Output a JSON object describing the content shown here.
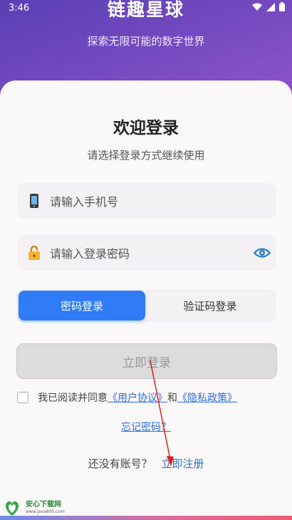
{
  "status_bar": {
    "time": "3:46"
  },
  "header": {
    "app_title": "链趣星球",
    "subtitle": "探索无限可能的数字世界"
  },
  "login": {
    "title": "欢迎登录",
    "subtitle": "请选择登录方式继续使用",
    "phone_placeholder": "请输入手机号",
    "password_placeholder": "请输入登录密码",
    "tabs": [
      {
        "label": "密码登录",
        "active": true
      },
      {
        "label": "验证码登录",
        "active": false
      }
    ],
    "submit_label": "立即登录",
    "agreement": {
      "prefix": "我已阅读并同意",
      "user_agreement": "《用户协议》",
      "and": "和",
      "privacy_policy": "《隐私政策》"
    },
    "forgot_password": "忘记密码？",
    "register_prompt": "还没有账号？",
    "register_link": "立即注册"
  },
  "watermark": {
    "name": "安心下载网",
    "url": "www.java800.com"
  },
  "colors": {
    "accent": "#2f7cf6",
    "link": "#2f6fd6",
    "disabled_button": "#dcdcdc"
  },
  "icons": [
    "phone-icon",
    "lock-icon",
    "eye-icon",
    "wifi-icon",
    "signal-icon",
    "battery-icon"
  ]
}
